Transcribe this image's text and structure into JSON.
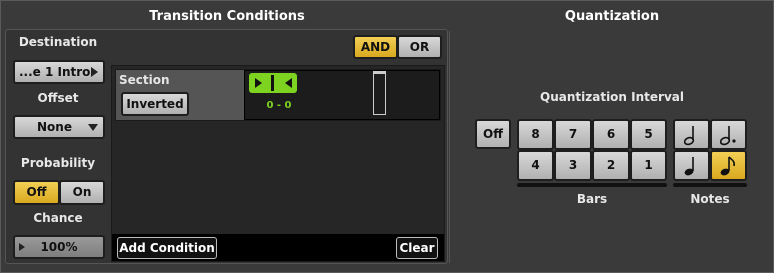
{
  "transition": {
    "title": "Transition Conditions",
    "destination_label": "Destination",
    "destination_value": "...e 1 Intro",
    "offset_label": "Offset",
    "offset_value": "None",
    "probability_label": "Probability",
    "probability_off": "Off",
    "probability_on": "On",
    "probability_selected": "Off",
    "chance_label": "Chance",
    "chance_value": "100%",
    "logic_and": "AND",
    "logic_or": "OR",
    "logic_selected": "AND",
    "condition": {
      "name": "Section",
      "inverted_label": "Inverted",
      "range_text": "0 - 0"
    },
    "add_condition_label": "Add Condition",
    "clear_label": "Clear"
  },
  "quantization": {
    "title": "Quantization",
    "interval_label": "Quantization Interval",
    "off_label": "Off",
    "bars_row1": [
      "8",
      "7",
      "6",
      "5"
    ],
    "bars_row2": [
      "4",
      "3",
      "2",
      "1"
    ],
    "bars_label": "Bars",
    "notes_label": "Notes",
    "notes": [
      "half-note",
      "dotted-half-note",
      "quarter-note",
      "eighth-note"
    ],
    "selected_note": "eighth-note"
  },
  "colors": {
    "accent": "#f2c94c",
    "green": "#7ed321",
    "panel": "#262626"
  }
}
